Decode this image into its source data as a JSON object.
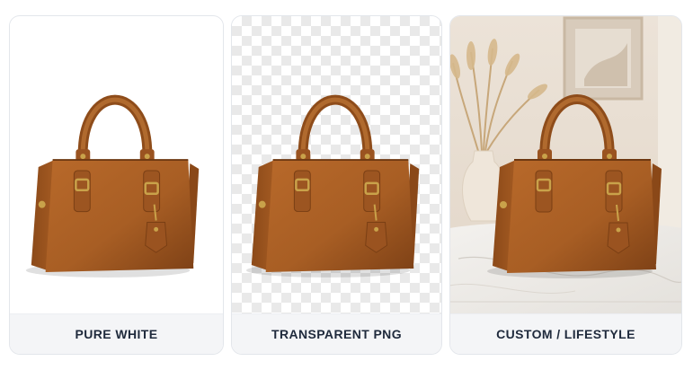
{
  "cards": [
    {
      "label": "PURE WHITE",
      "background": "white",
      "image": "handbag-photo"
    },
    {
      "label": "TRANSPARENT PNG",
      "background": "checkerboard",
      "image": "handbag-photo"
    },
    {
      "label": "CUSTOM / LIFESTYLE",
      "background": "lifestyle-scene",
      "image": "handbag-photo"
    }
  ],
  "colors": {
    "leather": "#a85e24",
    "leather_dark": "#7a3f14",
    "hardware": "#c9a24a",
    "caption_bg": "#f4f5f7",
    "caption_text": "#1f2a3c"
  }
}
